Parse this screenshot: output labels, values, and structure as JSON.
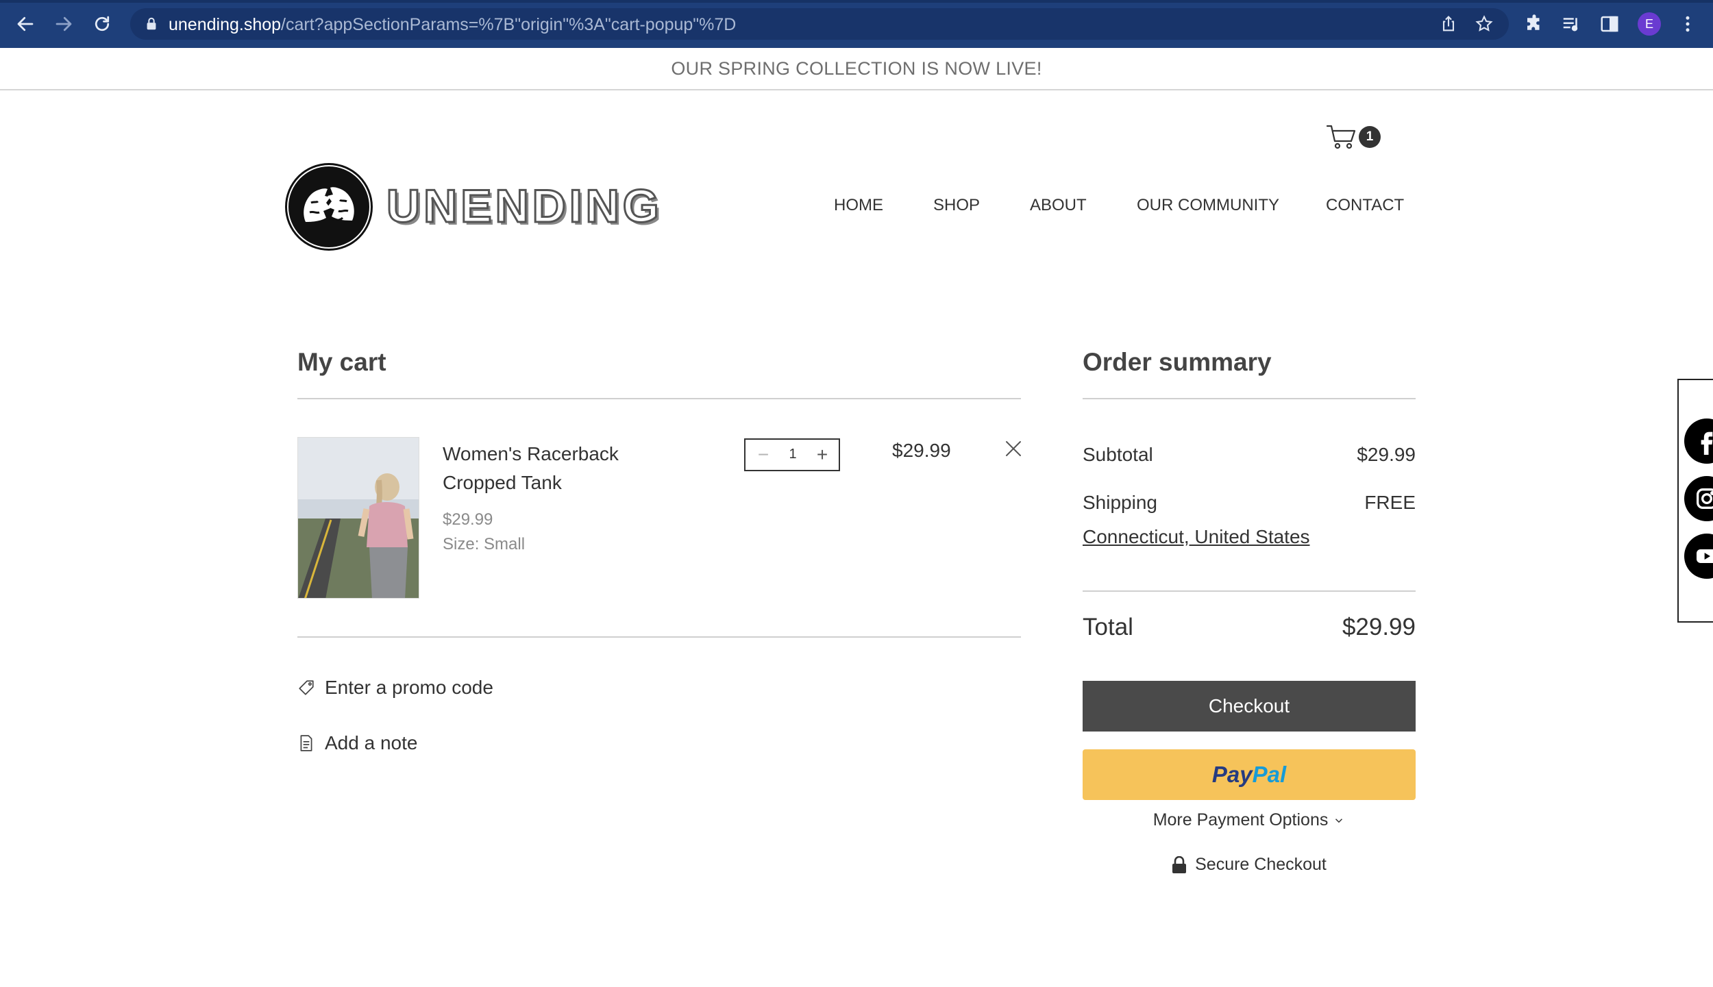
{
  "browser": {
    "url_host": "unending.shop",
    "url_path": "/cart?appSectionParams=%7B\"origin\"%3A\"cart-popup\"%7D",
    "profile_initial": "E"
  },
  "announcement": "OUR SPRING COLLECTION IS NOW LIVE!",
  "header": {
    "brand": "UNENDING",
    "cart_count": "1",
    "nav": [
      "HOME",
      "SHOP",
      "ABOUT",
      "OUR COMMUNITY",
      "CONTACT"
    ]
  },
  "cart": {
    "title": "My cart",
    "item": {
      "name": "Women's Racerback Cropped Tank",
      "unit_price": "$29.99",
      "size": "Size: Small",
      "quantity": "1",
      "line_total": "$29.99"
    },
    "promo_label": "Enter a promo code",
    "note_label": "Add a note"
  },
  "summary": {
    "title": "Order summary",
    "subtotal_label": "Subtotal",
    "subtotal_value": "$29.99",
    "shipping_label": "Shipping",
    "shipping_value": "FREE",
    "shipping_location": "Connecticut, United States",
    "total_label": "Total",
    "total_value": "$29.99",
    "checkout_label": "Checkout",
    "paypal_part1": "Pay",
    "paypal_part2": "Pal",
    "more_payment_label": "More Payment Options",
    "secure_label": "Secure Checkout"
  },
  "social": [
    "facebook",
    "instagram",
    "youtube"
  ]
}
